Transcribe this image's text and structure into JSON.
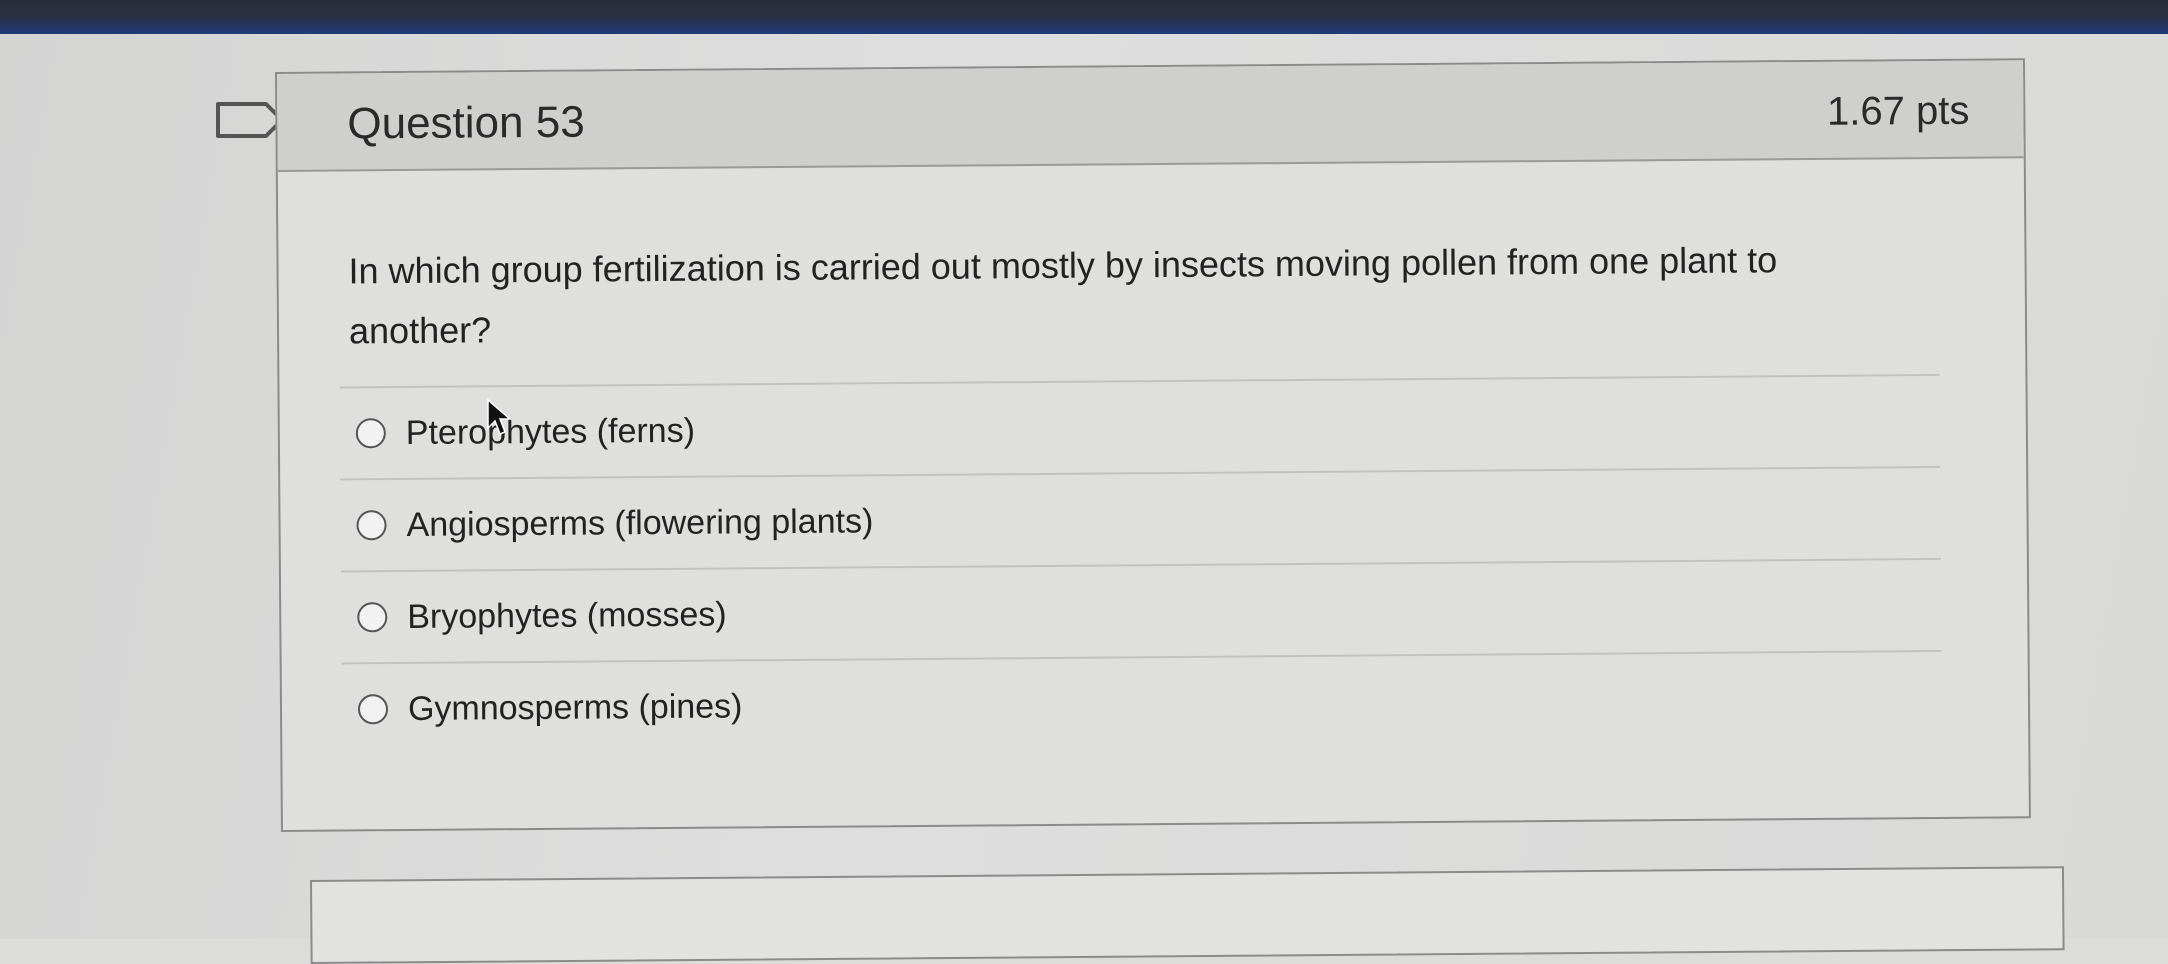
{
  "question": {
    "title": "Question 53",
    "points": "1.67 pts",
    "text": "In which group fertilization is carried out mostly by insects moving pollen from one plant to another?"
  },
  "answers": [
    {
      "label": "Pterophytes (ferns)"
    },
    {
      "label": "Angiosperms (flowering plants)"
    },
    {
      "label": "Bryophytes (mosses)"
    },
    {
      "label": "Gymnosperms (pines)"
    }
  ],
  "icons": {
    "flag": "flag-icon",
    "cursor": "mouse-cursor-icon",
    "radio": "radio-button"
  },
  "colors": {
    "topbar": "#1f3b7a",
    "card_header": "#cfcfce",
    "border": "#8b8b8b"
  }
}
